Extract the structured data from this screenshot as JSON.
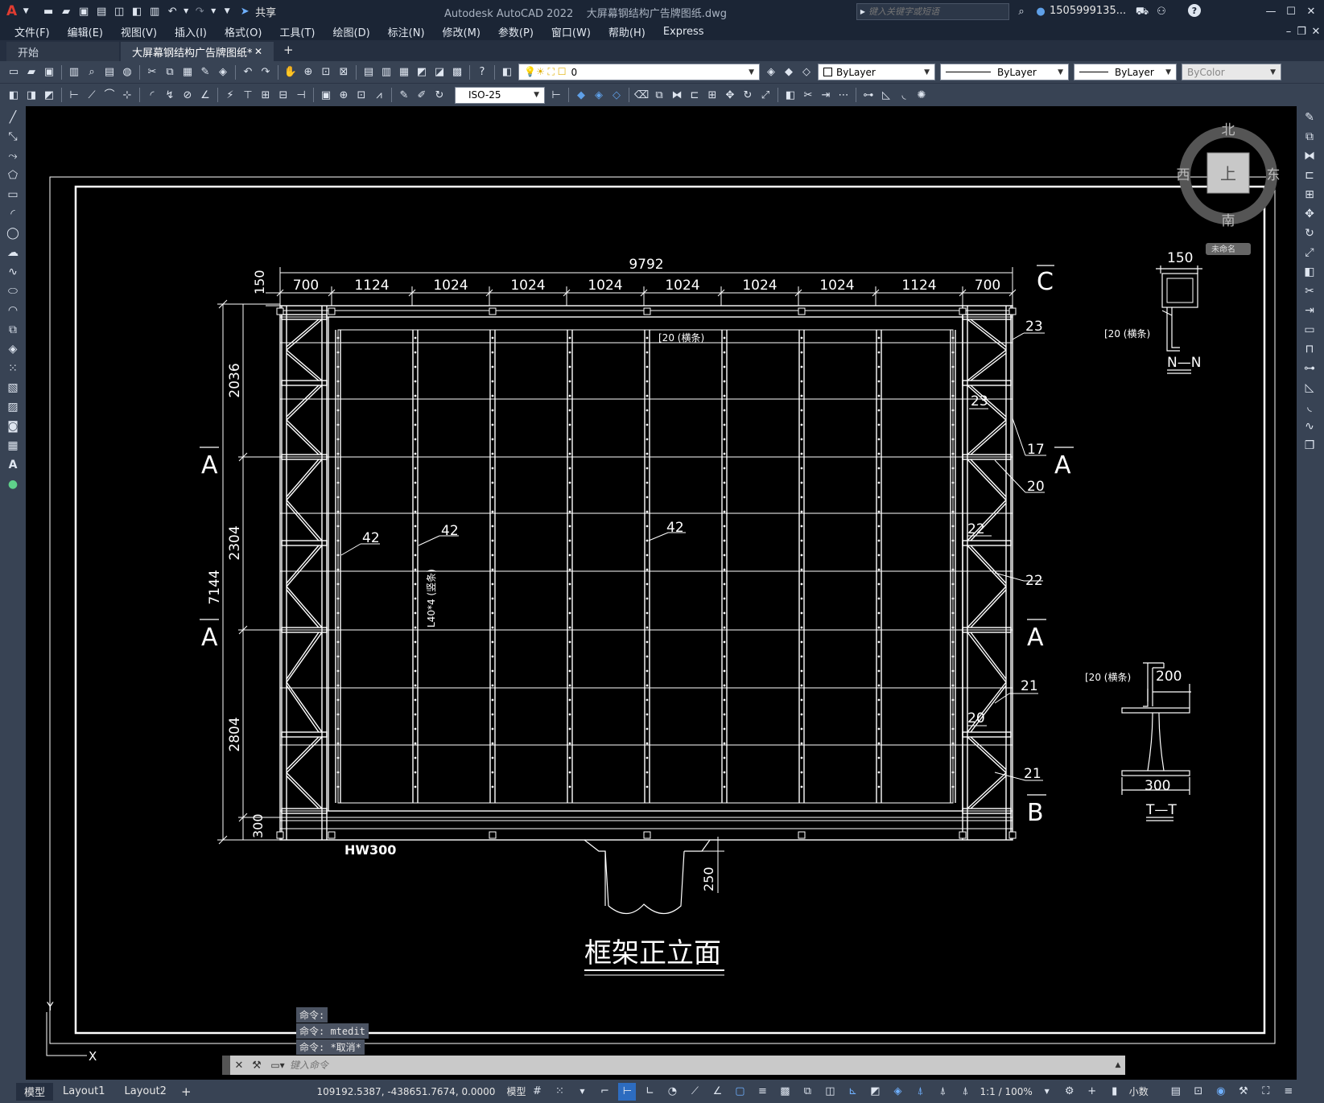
{
  "colors": {
    "chrome": "#1b2535",
    "toolbar": "#384354",
    "canvas": "#000000",
    "line": "#ffffff",
    "accent": "#2d6cc0",
    "logo": "#e03c31"
  },
  "titlebar": {
    "logo": "A",
    "share_label": "共享",
    "title": "Autodesk AutoCAD 2022    大屏幕钢结构广告牌图纸.dwg",
    "search_placeholder": "键入关键字或短语",
    "user": "1505999135..."
  },
  "menu": [
    "文件(F)",
    "编辑(E)",
    "视图(V)",
    "插入(I)",
    "格式(O)",
    "工具(T)",
    "绘图(D)",
    "标注(N)",
    "修改(M)",
    "参数(P)",
    "窗口(W)",
    "帮助(H)",
    "Express"
  ],
  "tabs": [
    {
      "label": "开始"
    },
    {
      "label": "大屏幕钢结构广告牌图纸*"
    }
  ],
  "toolbar": {
    "layer_value": "0",
    "color_value": "ByLayer",
    "linetype_value": "ByLayer",
    "lineweight_value": "ByLayer",
    "plotstyle_value": "ByColor",
    "dimstyle_value": "ISO-25"
  },
  "viewcube": {
    "north": "北",
    "south": "南",
    "east": "东",
    "west": "西",
    "top": "上",
    "ucs": "未命名"
  },
  "drawing": {
    "overall_width": "9792",
    "top_dims": [
      "700",
      "1124",
      "1024",
      "1024",
      "1024",
      "1024",
      "1024",
      "1024",
      "1124",
      "700"
    ],
    "dim_150_top": "150",
    "left_overall": "7144",
    "left_dims": [
      "2036",
      "2304",
      "2804"
    ],
    "dim_300_bottom": "300",
    "dim_250": "250",
    "purlin_note": "[20 (横条)",
    "angle_note": "L40*4 (竖条)",
    "hw_label": "HW300",
    "leader_labels": {
      "l42a": "42",
      "l42b": "42",
      "l42c": "42",
      "r23a": "23",
      "r23b": "23",
      "r17": "17",
      "r20a": "20",
      "r22a": "22",
      "r22b": "22",
      "r21a": "21",
      "r20b": "20",
      "r21b": "21"
    },
    "section_marks": {
      "c": "C",
      "a": "A",
      "b": "B"
    },
    "title": "框架正立面",
    "nn": {
      "dim": "150",
      "note": "[20 (横条)",
      "label": "N—N"
    },
    "tt": {
      "dim_top": "200",
      "dim_bottom": "300",
      "note": "[20 (横条)",
      "label": "T—T"
    },
    "ucs_x": "X",
    "ucs_y": "Y"
  },
  "command": {
    "history": [
      "命令:",
      "命令:  mtedit",
      "命令: *取消*"
    ],
    "placeholder": "键入命令"
  },
  "status": {
    "layout_tabs": [
      "模型",
      "Layout1",
      "Layout2"
    ],
    "coords": "109192.5387, -438651.7674, 0.0000",
    "model": "模型",
    "scale": "1:1 / 100%",
    "units": "小数"
  }
}
